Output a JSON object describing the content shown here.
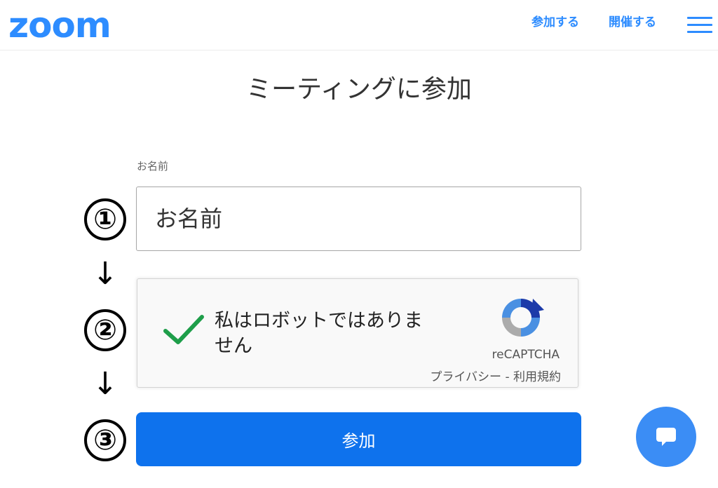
{
  "header": {
    "logo_text": "zoom",
    "nav_join": "参加する",
    "nav_host": "開催する",
    "menu_icon": "hamburger-menu-icon"
  },
  "main": {
    "title": "ミーティングに参加",
    "name_label": "お名前",
    "name_placeholder": "お名前",
    "join_button": "参加"
  },
  "recaptcha": {
    "checked": true,
    "label": "私はロボットではありません",
    "brand": "reCAPTCHA",
    "privacy": "プライバシー",
    "separator": " - ",
    "terms": "利用規約"
  },
  "annotations": {
    "step1": "①",
    "step2": "②",
    "step3": "③",
    "arrow": "↓"
  },
  "chat": {
    "icon": "chat-bubble-icon"
  },
  "colors": {
    "brand": "#2d8cff",
    "button": "#0e72ed",
    "check": "#1e9e4a"
  }
}
